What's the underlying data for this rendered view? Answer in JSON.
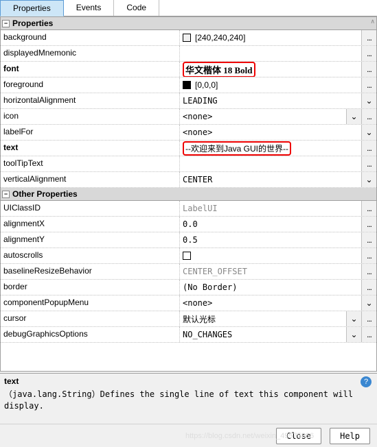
{
  "tabs": {
    "properties": "Properties",
    "events": "Events",
    "code": "Code"
  },
  "sections": {
    "properties": "Properties",
    "other": "Other Properties"
  },
  "props": {
    "background": {
      "label": "background",
      "value": "[240,240,240]",
      "swatch": "#f0f0f0"
    },
    "displayedMnemonic": {
      "label": "displayedMnemonic",
      "value": ""
    },
    "font": {
      "label": "font",
      "value": "华文楷体 18 Bold"
    },
    "foreground": {
      "label": "foreground",
      "value": "[0,0,0]",
      "swatch": "#000000"
    },
    "horizontalAlignment": {
      "label": "horizontalAlignment",
      "value": "LEADING"
    },
    "icon": {
      "label": "icon",
      "value": "<none>"
    },
    "labelFor": {
      "label": "labelFor",
      "value": "<none>"
    },
    "text": {
      "label": "text",
      "value": "--欢迎来到Java GUI的世界--"
    },
    "toolTipText": {
      "label": "toolTipText",
      "value": ""
    },
    "verticalAlignment": {
      "label": "verticalAlignment",
      "value": "CENTER"
    }
  },
  "other": {
    "UIClassID": {
      "label": "UIClassID",
      "value": "LabelUI"
    },
    "alignmentX": {
      "label": "alignmentX",
      "value": "0.0"
    },
    "alignmentY": {
      "label": "alignmentY",
      "value": "0.5"
    },
    "autoscrolls": {
      "label": "autoscrolls",
      "checked": false
    },
    "baselineResizeBehavior": {
      "label": "baselineResizeBehavior",
      "value": "CENTER_OFFSET"
    },
    "border": {
      "label": "border",
      "value": "(No Border)"
    },
    "componentPopupMenu": {
      "label": "componentPopupMenu",
      "value": "<none>"
    },
    "cursor": {
      "label": "cursor",
      "value": "默认光标"
    },
    "debugGraphicsOptions": {
      "label": "debugGraphicsOptions",
      "value": "NO_CHANGES"
    }
  },
  "desc": {
    "title": "text",
    "body": "（java.lang.String）Defines the single line of text this component will display."
  },
  "footer": {
    "close": "Close",
    "help": "Help"
  },
  "watermark": "https://blog.csdn.net/weixin_49575866"
}
